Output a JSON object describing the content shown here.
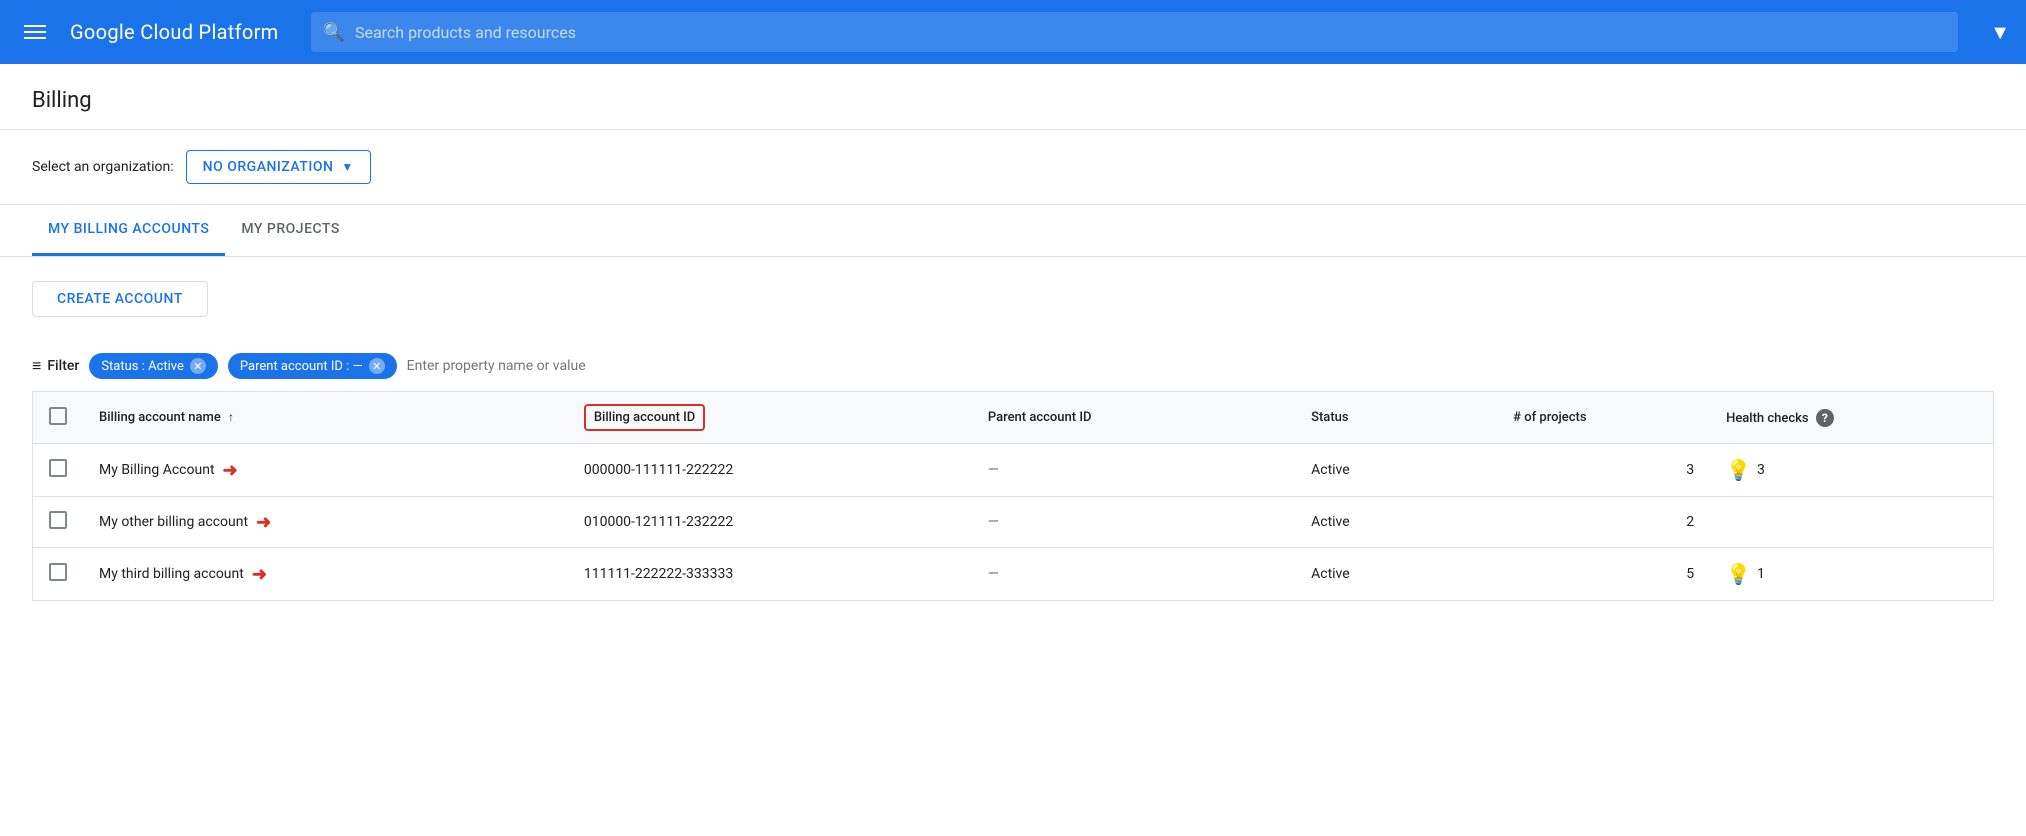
{
  "header": {
    "menu_icon_label": "Menu",
    "logo": "Google Cloud Platform",
    "search_placeholder": "Search products and resources",
    "dropdown_arrow": "▼"
  },
  "page": {
    "title": "Billing"
  },
  "org_selector": {
    "label": "Select an organization:",
    "selected": "NO ORGANIZATION",
    "arrow": "▼"
  },
  "tabs": [
    {
      "id": "billing-accounts",
      "label": "MY BILLING ACCOUNTS",
      "active": true
    },
    {
      "id": "projects",
      "label": "MY PROJECTS",
      "active": false
    }
  ],
  "toolbar": {
    "create_account_label": "CREATE ACCOUNT"
  },
  "filter": {
    "label": "Filter",
    "chips": [
      {
        "id": "status-chip",
        "text": "Status : Active"
      },
      {
        "id": "parent-chip",
        "text": "Parent account ID : —"
      }
    ],
    "input_placeholder": "Enter property name or value"
  },
  "table": {
    "columns": [
      {
        "id": "checkbox",
        "label": ""
      },
      {
        "id": "name",
        "label": "Billing account name",
        "sort": "↑",
        "highlighted": false
      },
      {
        "id": "billing-id",
        "label": "Billing account ID",
        "highlighted": true
      },
      {
        "id": "parent-id",
        "label": "Parent account ID"
      },
      {
        "id": "status",
        "label": "Status"
      },
      {
        "id": "projects",
        "label": "# of projects"
      },
      {
        "id": "health",
        "label": "Health checks"
      }
    ],
    "rows": [
      {
        "id": "row-1",
        "name": "My Billing Account",
        "billing_id": "000000-111111-222222",
        "parent_id": "—",
        "status": "Active",
        "num_projects": "3",
        "health_count": "3",
        "has_health": true
      },
      {
        "id": "row-2",
        "name": "My other billing account",
        "billing_id": "010000-121111-232222",
        "parent_id": "—",
        "status": "Active",
        "num_projects": "2",
        "health_count": "",
        "has_health": false
      },
      {
        "id": "row-3",
        "name": "My third billing account",
        "billing_id": "111111-222222-333333",
        "parent_id": "—",
        "status": "Active",
        "num_projects": "5",
        "health_count": "1",
        "has_health": true
      }
    ]
  }
}
